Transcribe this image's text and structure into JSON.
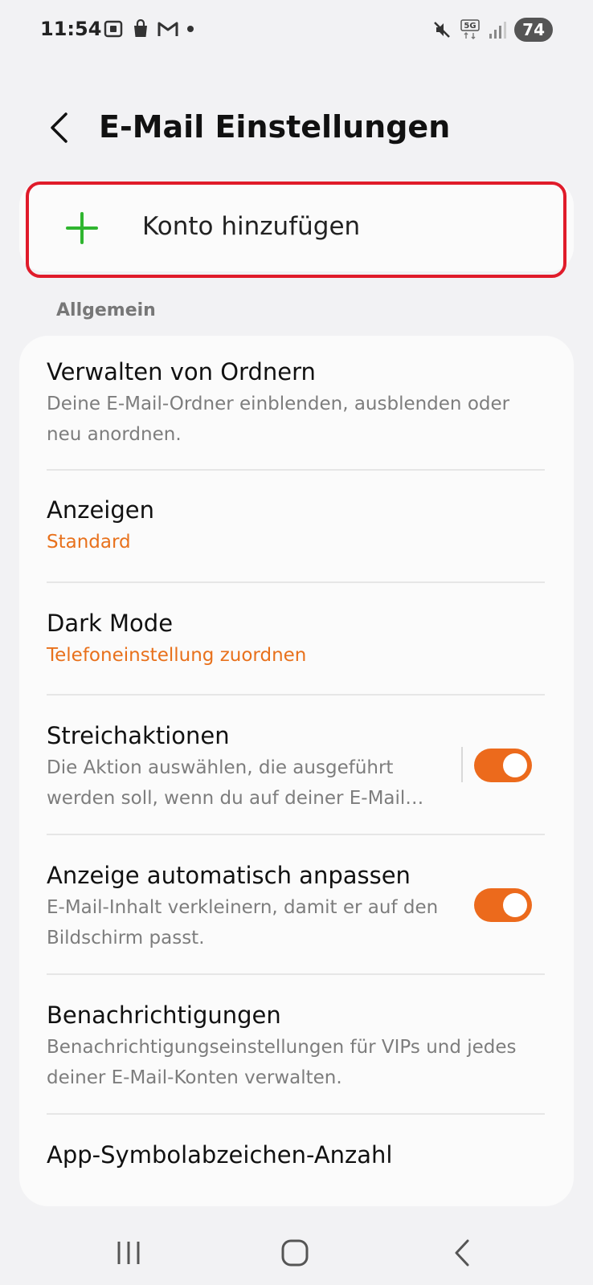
{
  "status_bar": {
    "time": "11:54",
    "battery": "74",
    "left_icons": [
      "screenshot-icon",
      "shopping-bag-icon",
      "gmail-icon",
      "dot-icon"
    ],
    "right_icons": [
      "mute-icon",
      "5g-icon",
      "signal-icon"
    ]
  },
  "header": {
    "title": "E-Mail Einstellungen"
  },
  "add_account": {
    "label": "Konto hinzufügen",
    "icon": "plus-icon",
    "icon_color": "#2fb52f",
    "highlight_color": "#e01b2a"
  },
  "general_section": {
    "heading": "Allgemein",
    "items": [
      {
        "title": "Verwalten von Ordnern",
        "subtitle": "Deine E-Mail-Ordner einblenden, ausblenden oder neu anordnen."
      },
      {
        "title": "Anzeigen",
        "subtitle": "Standard"
      },
      {
        "title": "Dark Mode",
        "subtitle": "Telefoneinstellung zuordnen"
      },
      {
        "title": "Streichaktionen",
        "subtitle": "Die Aktion auswählen, die ausgeführt werden soll, wenn du auf deiner E-Mail…",
        "toggle": "on"
      },
      {
        "title": "Anzeige automatisch anpassen",
        "subtitle": "E-Mail-Inhalt verkleinern, damit er auf den Bildschirm passt.",
        "toggle": "on"
      },
      {
        "title": "Benachrichtigungen",
        "subtitle": "Benachrichtigungseinstellungen für VIPs und jedes deiner E-Mail-Konten verwalten."
      },
      {
        "title": "App-Symbolabzeichen-Anzahl"
      }
    ]
  },
  "colors": {
    "accent": "#e8711c",
    "toggle_on": "#ec6a1c",
    "background": "#f2f2f4"
  },
  "nav_bar": {
    "icons": [
      "recent-apps-icon",
      "home-icon",
      "back-icon"
    ]
  }
}
